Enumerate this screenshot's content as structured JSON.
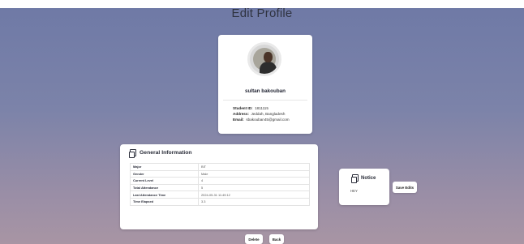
{
  "page": {
    "title": "Edit Profile"
  },
  "profile": {
    "name": "sultan bakouban",
    "student_id_label": "Student ID:",
    "student_id": "1811115",
    "address_label": "Address:",
    "address": "Jeddah, Bangladesh",
    "email_label": "Email:",
    "email": "sbakouban45@gmail.com"
  },
  "general": {
    "title": "General Information",
    "rows": [
      {
        "key": "Major",
        "value": "BIT"
      },
      {
        "key": "Gender",
        "value": "Male"
      },
      {
        "key": "Current Level",
        "value": "4"
      },
      {
        "key": "Total Attendance",
        "value": "5"
      },
      {
        "key": "Last Attendance Time",
        "value": "2024-05-31 11:49:12"
      },
      {
        "key": "Time Elapsed",
        "value": "3.3"
      }
    ]
  },
  "notice": {
    "title": "Notice",
    "body": "HEY"
  },
  "buttons": {
    "save": "Save Edits",
    "delete": "Delete",
    "back": "Back"
  },
  "colors": {
    "background_top": "#6e79a6",
    "background_bottom": "#a895a4",
    "card": "#ffffff"
  },
  "icons": {
    "general": "document-icon",
    "notice": "document-icon"
  }
}
